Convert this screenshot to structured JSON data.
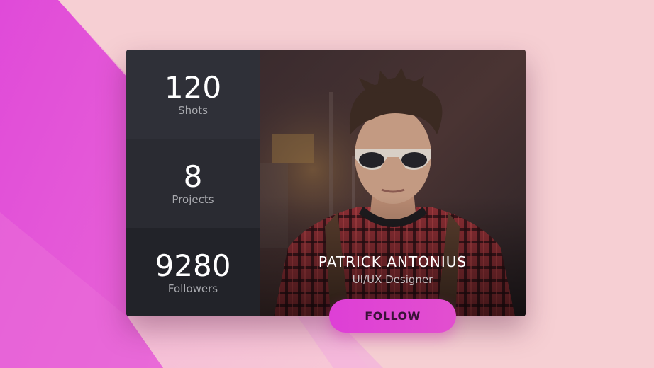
{
  "stats": [
    {
      "value": "120",
      "label": "Shots"
    },
    {
      "value": "8",
      "label": "Projects"
    },
    {
      "value": "9280",
      "label": "Followers"
    }
  ],
  "profile": {
    "name": "PATRICK ANTONIUS",
    "role": "UI/UX Designer"
  },
  "actions": {
    "follow_label": "FOLLOW"
  },
  "colors": {
    "page_background": "#f6cfd3",
    "accent_magenta": "#e24fd8",
    "stats_panel": "#2a2b32"
  }
}
